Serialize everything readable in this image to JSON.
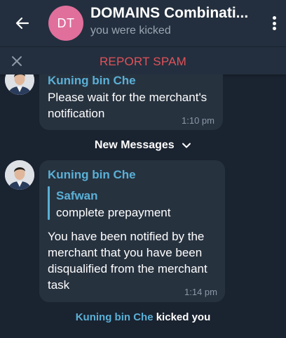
{
  "header": {
    "avatar_initials": "DT",
    "title": "DOMAINS Combinati...",
    "subtitle": "you were kicked"
  },
  "spam_bar": {
    "label": "REPORT SPAM"
  },
  "messages": [
    {
      "sender": "Kuning bin Che",
      "lines": [
        "Please wait for the merchant's",
        "notification"
      ],
      "time": "1:10 pm"
    },
    {
      "sender": "Kuning bin Che",
      "reply": {
        "name": "Safwan",
        "text": "complete prepayment"
      },
      "lines": [
        "You have been notified by the",
        "merchant that you have been",
        "disqualified from the merchant",
        "task"
      ],
      "time": "1:14 pm"
    }
  ],
  "new_messages_label": "New Messages",
  "service_message": {
    "actor": "Kuning bin Che",
    "action": "kicked you"
  },
  "colors": {
    "background": "#1a2330",
    "header": "#232f3e",
    "bubble": "#27323f",
    "accent": "#5bb0d6",
    "spam": "#e0525a",
    "avatar_dt": "#e06f9c"
  },
  "icons": {
    "back": "arrow-left-icon",
    "menu": "more-vertical-icon",
    "close": "close-icon",
    "chevron": "chevron-down-icon"
  }
}
